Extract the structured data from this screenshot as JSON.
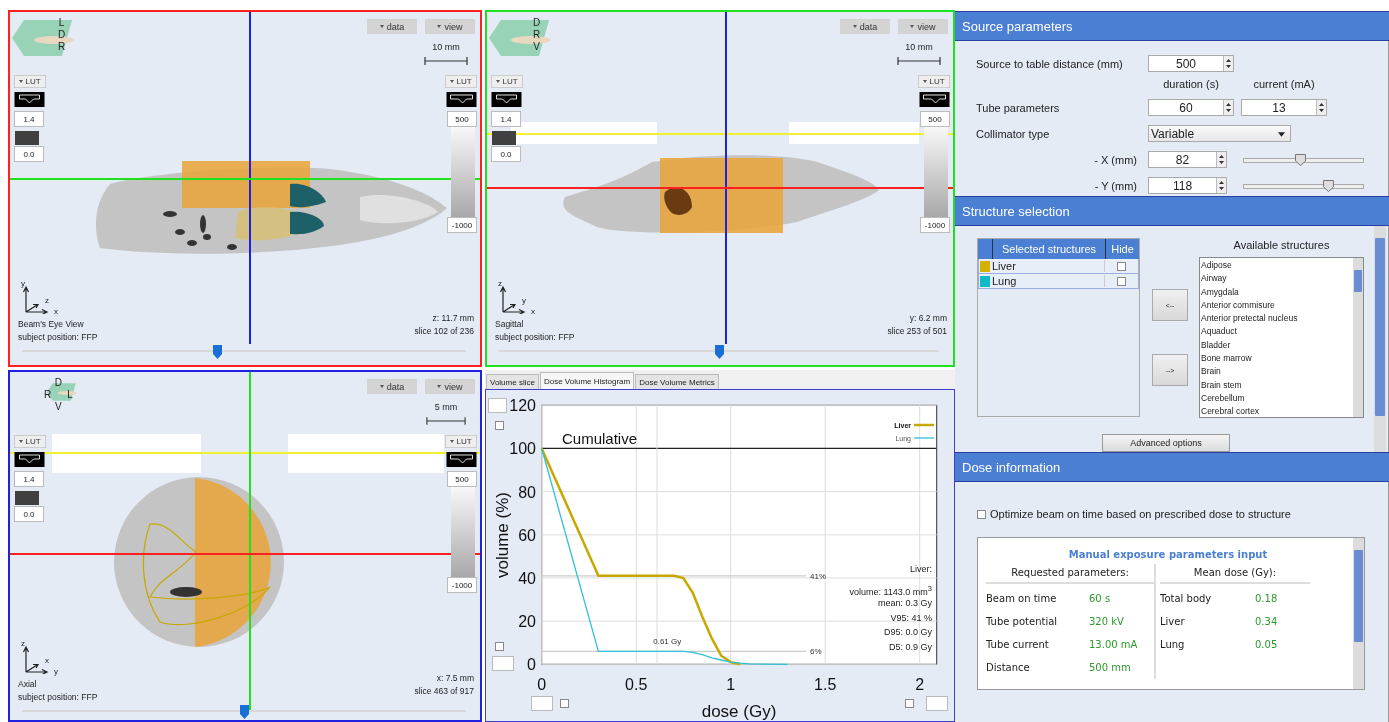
{
  "viewers": [
    {
      "color": "#ff2020",
      "kind": "dorsal",
      "orientation": [
        [
          "L"
        ],
        [
          "D"
        ],
        [
          "R"
        ]
      ],
      "buttons": [
        "data",
        "view"
      ],
      "scale": "10 mm",
      "lut_buttons": [
        "LUT",
        "LUT"
      ],
      "dose_range": [
        "1.4",
        "0.0"
      ],
      "ct_range": [
        "500",
        "-1000"
      ],
      "axes": [
        "y",
        "z",
        "x"
      ],
      "title": "Beam's Eye View",
      "position": "subject position: FFP",
      "coordinate": "z: 11.7 mm",
      "slice": "slice 102 of 236",
      "level": 0.44
    },
    {
      "color": "#20e020",
      "kind": "sagittal",
      "beam_line": true,
      "orientation": [
        [
          "D"
        ],
        [
          "R"
        ],
        [
          "V"
        ]
      ],
      "buttons": [
        "data",
        "view"
      ],
      "scale": "10 mm",
      "lut_buttons": [
        "LUT",
        "LUT"
      ],
      "dose_range": [
        "1.4",
        "0.0"
      ],
      "ct_range": [
        "500",
        "-1000"
      ],
      "axes": [
        "z",
        "y",
        "x"
      ],
      "title": "Sagittal",
      "position": "subject position: FFP",
      "coordinate": "y: 6.2 mm",
      "slice": "slice 253 of 501",
      "level": 0.5
    },
    {
      "color": "#2020e0",
      "kind": "axial",
      "beam_line": true,
      "orientation": [
        [
          "D"
        ],
        [
          "R",
          "L"
        ],
        [
          "V"
        ]
      ],
      "buttons": [
        "data",
        "view"
      ],
      "scale": "5 mm",
      "lut_buttons": [
        "LUT",
        "LUT"
      ],
      "dose_range": [
        "1.4",
        "0.0"
      ],
      "ct_range": [
        "500",
        "-1000"
      ],
      "axes": [
        "z",
        "x",
        "y"
      ],
      "title": "Axial",
      "position": "subject position: FFP",
      "coordinate": "x: 7.5 mm",
      "slice": "slice 463 of 917",
      "level": 0.5
    }
  ],
  "histogram_panel": {
    "tabs": [
      {
        "label": "Volume slice",
        "selected": false
      },
      {
        "label": "Dose Volume Histogram",
        "selected": true
      },
      {
        "label": "Dose Volume Metrics",
        "selected": false
      }
    ],
    "subtitle": "Cumulative",
    "axis_checkboxes": [
      {
        "checked": false
      },
      {
        "checked": false
      },
      {
        "checked": false
      },
      {
        "checked": false
      }
    ],
    "stats": [
      "Liver:",
      "volume: 1143.0 mm$^{3}$",
      "mean: 0.3 Gy",
      "V95:  41 %",
      "D95: 0.0 Gy",
      "D5: 0.9 Gy"
    ],
    "chart_data": {
      "type": "line",
      "xlabel": "dose (Gy)",
      "ylabel": "volume (%)",
      "x": [
        0,
        0.3,
        0.6,
        0.7,
        0.75,
        0.8,
        0.85,
        0.9,
        0.95,
        1.0,
        1.05,
        1.1,
        1.3
      ],
      "series": [
        {
          "name": "Liver",
          "color": "#c8a800",
          "values": [
            100,
            41,
            41,
            41,
            40,
            33,
            22,
            12,
            4,
            1,
            0,
            null,
            null
          ]
        },
        {
          "name": "Lung",
          "color": "#30c0d8",
          "values": [
            100,
            6,
            6,
            6,
            6,
            5.5,
            4.5,
            3,
            2,
            1,
            0.5,
            0.2,
            0
          ]
        }
      ],
      "xlim": [
        0,
        2.09
      ],
      "ylim": [
        0,
        120
      ],
      "xticks": [
        0,
        0.5,
        1,
        1.5,
        2
      ],
      "yticks": [
        0,
        20,
        40,
        60,
        80,
        100,
        120
      ],
      "grid": true,
      "legend": "upper right",
      "ref_lines": [
        {
          "axis": "y",
          "value": 100
        },
        {
          "axis": "y",
          "value": 41
        },
        {
          "axis": "y",
          "value": 6
        },
        {
          "axis": "x",
          "value": 0.61
        }
      ],
      "annotations": [
        "41%",
        "6%",
        "0.61 Gy"
      ]
    }
  },
  "source_parameters": {
    "title": "Source parameters",
    "distance": {
      "label": "Source to table distance (mm)",
      "value": "500"
    },
    "column_headers": [
      "duration (s)",
      "current (mA)"
    ],
    "tube": {
      "label": "Tube parameters",
      "values": [
        "60",
        "13"
      ]
    },
    "collimator": {
      "label": "Collimator type",
      "value": "Variable"
    },
    "apertures": [
      {
        "label": "- X (mm)",
        "value": "82",
        "level": 0.47
      },
      {
        "label": "- Y (mm)",
        "value": "118",
        "level": 0.7
      }
    ]
  },
  "structure_selection": {
    "title": "Structure selection",
    "columns": [
      "Selected structures",
      "Hide"
    ],
    "selected": [
      {
        "name": "Liver",
        "color": "#d4b000",
        "hidden": false
      },
      {
        "name": "Lung",
        "color": "#10b8c8",
        "hidden": false
      }
    ],
    "remove_button": "<--",
    "add_button": "-->",
    "available_title": "Available structures",
    "available": [
      "Adipose",
      "Airway",
      "Amygdala",
      "Anterior commisure",
      "Anterior pretectal nucleus",
      "Aquaduct",
      "Bladder",
      "Bone marrow",
      "Brain",
      "Brain stem",
      "Cerebellum",
      "Cerebral cortex"
    ],
    "advanced_button": "Advanced options"
  },
  "dose_information": {
    "title": "Dose information",
    "optimize": {
      "label": "Optimize beam on time based on prescribed dose to structure",
      "checked": false
    },
    "manual": {
      "title": "Manual exposure parameters input",
      "headers": [
        "Requested parameters:",
        "Mean dose (Gy):"
      ],
      "requested": [
        {
          "label": "Beam on time",
          "value": "60 s"
        },
        {
          "label": "Tube potential",
          "value": "320 kV"
        },
        {
          "label": "Tube current",
          "value": "13.00 mA"
        },
        {
          "label": "Distance",
          "value": "500 mm"
        }
      ],
      "mean_dose": [
        {
          "label": "Total body",
          "value": "0.18"
        },
        {
          "label": "Liver",
          "value": "0.34"
        },
        {
          "label": "Lung",
          "value": "0.05"
        }
      ]
    }
  }
}
